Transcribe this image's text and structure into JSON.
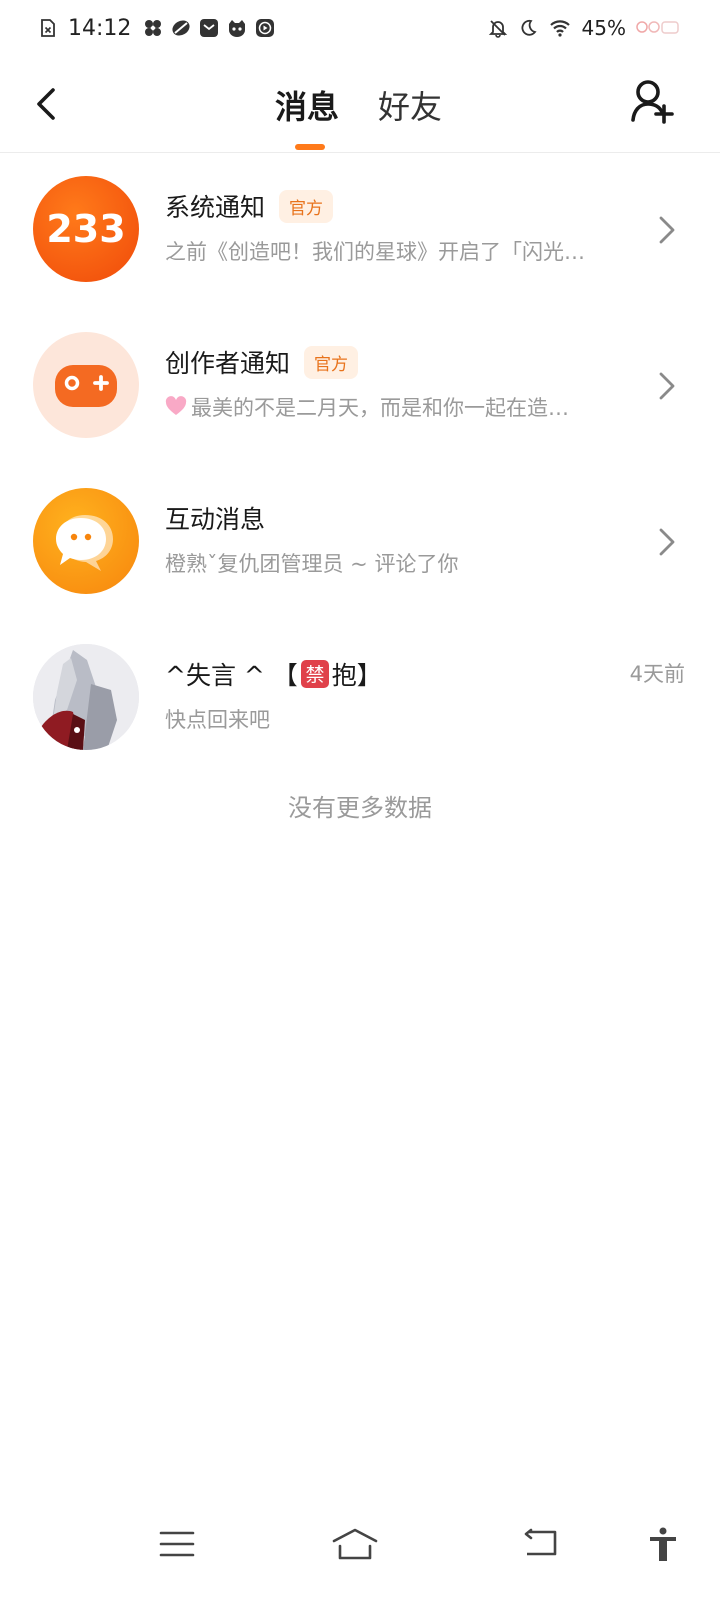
{
  "status": {
    "time": "14:12",
    "battery": "45%"
  },
  "header": {
    "tabs": [
      "消息",
      "好友"
    ],
    "active_tab": "消息"
  },
  "colors": {
    "accent": "#ff7a1a",
    "badge_bg": "#fff0e3",
    "badge_text": "#e8731c",
    "muted": "#9a9a9a"
  },
  "conversations": [
    {
      "title": "系统通知",
      "badge": "官方",
      "preview": "之前《创造吧！我们的星球》开启了「闪光…",
      "avatar_text": "233",
      "avatar_icon": "233-logo-icon"
    },
    {
      "title": "创作者通知",
      "badge": "官方",
      "preview": "最美的不是二月天，而是和你一起在造…",
      "avatar_icon": "gamepad-icon"
    },
    {
      "title": "互动消息",
      "preview": "橙熟ˇ复仇团管理员 ~ 评论了你",
      "avatar_icon": "chat-bubble-icon"
    },
    {
      "title_prefix": "^失言 ^ 【",
      "title_suffix": "抱】",
      "title_emoji": "禁",
      "preview": "快点回来吧",
      "time": "4天前",
      "avatar_icon": "user-avatar"
    }
  ],
  "footer": {
    "no_more": "没有更多数据"
  }
}
